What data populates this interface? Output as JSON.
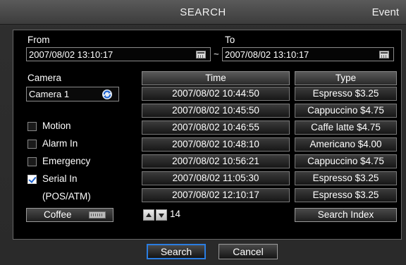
{
  "header": {
    "title": "SEARCH",
    "right_label": "Event"
  },
  "range": {
    "from_label": "From",
    "from_value": "2007/08/02 13:10:17",
    "separator": "~",
    "to_label": "To",
    "to_value": "2007/08/02 13:10:17"
  },
  "camera": {
    "label": "Camera",
    "value": "Camera 1"
  },
  "filters": [
    {
      "label": "Motion",
      "checked": false
    },
    {
      "label": "Alarm In",
      "checked": false
    },
    {
      "label": "Emergency",
      "checked": false
    },
    {
      "label": "Serial In",
      "checked": true
    }
  ],
  "pos_note": "(POS/ATM)",
  "keyword_button": "Coffee",
  "table": {
    "columns": [
      "Time",
      "Type"
    ],
    "rows": [
      [
        "2007/08/02 10:44:50",
        "Espresso $3.25"
      ],
      [
        "2007/08/02 10:45:50",
        "Cappuccino $4.75"
      ],
      [
        "2007/08/02 10:46:55",
        "Caffe latte $4.75"
      ],
      [
        "2007/08/02 10:48:10",
        "Americano $4.00"
      ],
      [
        "2007/08/02 10:56:21",
        "Cappuccino $4.75"
      ],
      [
        "2007/08/02 11:05:30",
        "Espresso $3.25"
      ],
      [
        "2007/08/02 12:10:17",
        "Espresso $3.25"
      ]
    ]
  },
  "pager": {
    "count": "14"
  },
  "search_index_button": "Search Index",
  "footer": {
    "search": "Search",
    "cancel": "Cancel"
  },
  "colors": {
    "focus_border": "#2a7de1",
    "checkbox_check": "#1d62d0"
  }
}
